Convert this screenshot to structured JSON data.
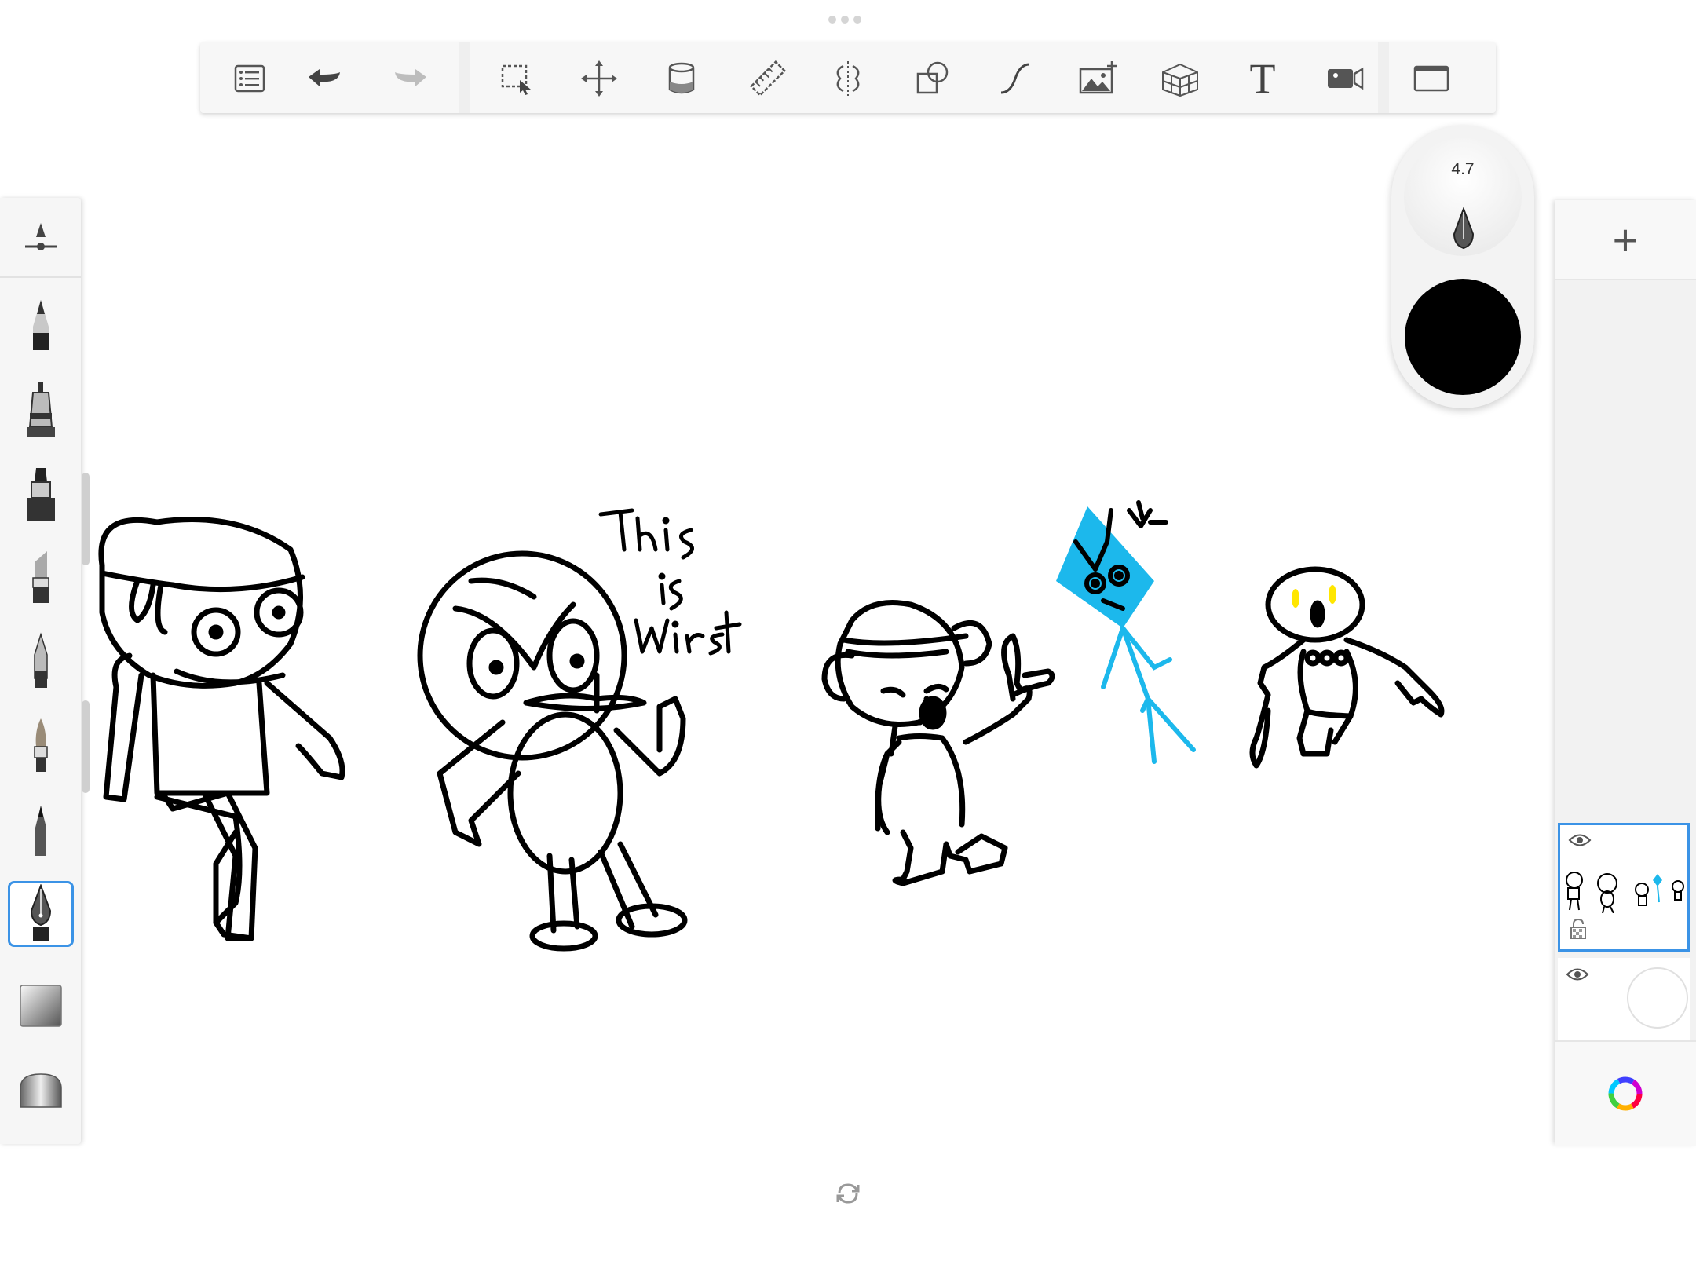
{
  "toolbar": {
    "items": [
      "list-icon",
      "undo-icon",
      "redo-icon",
      "selection-icon",
      "transform-icon",
      "fill-icon",
      "ruler-icon",
      "symmetry-icon",
      "shapes-icon",
      "curve-icon",
      "add-image-icon",
      "perspective-icon",
      "text-icon",
      "record-icon",
      "fullscreen-icon"
    ],
    "text_tool_glyph": "T"
  },
  "brushes": {
    "items": [
      "brush-properties",
      "pencil",
      "technical-pen",
      "marker",
      "chisel-marker",
      "ballpoint",
      "paintbrush",
      "fine-pen",
      "calligraphy-pen",
      "smudge-eraser",
      "eraser"
    ],
    "selected": "calligraphy-pen"
  },
  "puck": {
    "brush_size": "4.7",
    "current_color": "#000000"
  },
  "layers": {
    "add_label": "+",
    "items": [
      {
        "name": "drawing-layer",
        "visible": true,
        "locked": false,
        "selected": true
      },
      {
        "name": "background-layer",
        "visible": true,
        "selected": false
      }
    ]
  },
  "canvas": {
    "handwritten_text": [
      "This",
      "is",
      "wirst"
    ],
    "accent_colors": {
      "cyan": "#1cb8ec",
      "yellow": "#ffe600"
    }
  }
}
